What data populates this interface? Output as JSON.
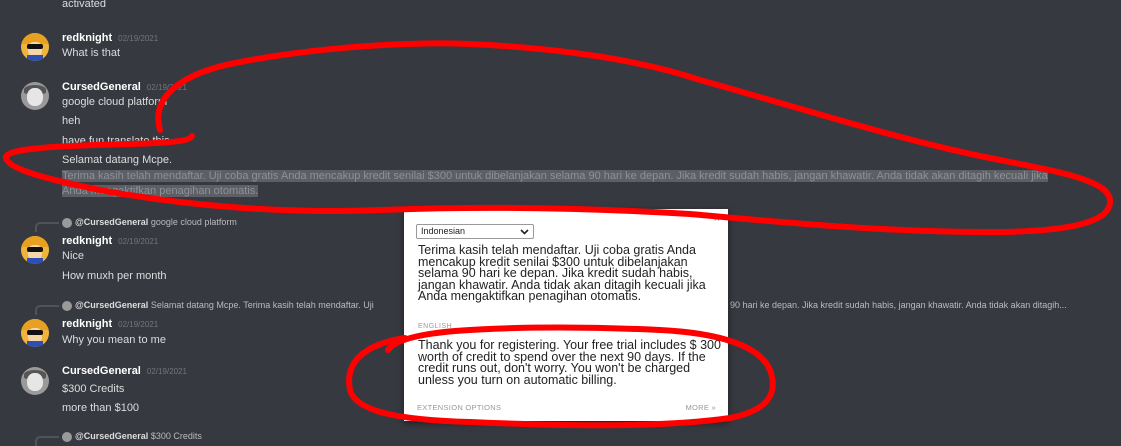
{
  "messages": {
    "activated": "activated",
    "m1": {
      "user": "redknight",
      "time": "02/19/2021",
      "text": "What is that"
    },
    "m2": {
      "user": "CursedGeneral",
      "time": "02/19/2021",
      "lines": [
        "google cloud platform",
        "heh",
        "have fun translate this",
        "Selamat datang Mcpe."
      ],
      "selected": "Terima kasih telah mendaftar. Uji coba gratis Anda mencakup kredit senilai $300 untuk dibelanjakan selama 90 hari ke depan. Jika kredit sudah habis, jangan khawatir. Anda tidak akan ditagih kecuali jika Anda mengaktifkan penagihan otomatis."
    },
    "reply1": {
      "mention": "@CursedGeneral",
      "text": "google cloud platform"
    },
    "m3": {
      "user": "redknight",
      "time": "02/19/2021",
      "lines": [
        "Nice",
        "How muxh per month"
      ]
    },
    "reply2": {
      "mention": "@CursedGeneral",
      "text": "Selamat datang Mcpe. Terima kasih telah mendaftar. Uji",
      "text_tail": "90 hari ke depan. Jika kredit sudah habis, jangan khawatir. Anda tidak akan ditagih..."
    },
    "m4": {
      "user": "redknight",
      "time": "02/19/2021",
      "text": "Why you mean to me"
    },
    "m5": {
      "user": "CursedGeneral",
      "time": "02/19/2021",
      "lines": [
        "$300 Credits",
        "more than $100"
      ]
    },
    "reply3": {
      "mention": "@CursedGeneral",
      "text": "$300 Credits"
    }
  },
  "popup": {
    "close": "×",
    "language": "Indonesian",
    "original": "Terima kasih telah mendaftar. Uji coba gratis Anda mencakup kredit senilai $300 untuk dibelanjakan selama 90 hari ke depan. Jika kredit sudah habis, jangan khawatir. Anda tidak akan ditagih kecuali jika Anda mengaktifkan penagihan otomatis.",
    "source_lang": "ENGLISH",
    "translation": "Thank you for registering. Your free trial includes $ 300 worth of credit to spend over the next 90 days. If the credit runs out, don't worry. You won't be charged unless you turn on automatic billing.",
    "extension_options": "EXTENSION OPTIONS",
    "more": "MORE »"
  },
  "colors": {
    "background": "#36393f",
    "annotation": "#ff0000",
    "selection": "#5c5f66"
  }
}
